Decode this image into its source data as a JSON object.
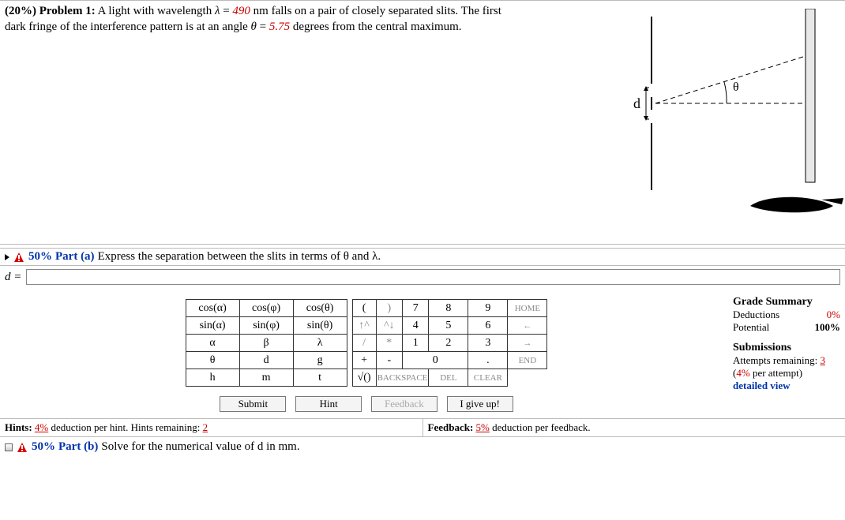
{
  "problem": {
    "weight_label": "(20%)  Problem 1:",
    "text_before_lambda": "   A light with wavelength ",
    "lambda_sym": "λ",
    "equals": " = ",
    "lambda_val": "490",
    "lambda_unit": " nm falls on a pair of closely separated slits. The first dark fringe of the interference pattern is at an angle ",
    "theta_sym": "θ",
    "theta_val": "5.75",
    "text_after": " degrees from the central maximum."
  },
  "diagram": {
    "d_label": "d",
    "theta_label": "θ"
  },
  "part_a": {
    "weight": "50%",
    "label": "Part (a)",
    "prompt": "  Express the separation between the slits in terms of θ and λ.",
    "lhs": "d = ",
    "input_value": ""
  },
  "keypad": {
    "funcs": [
      [
        "cos(α)",
        "cos(φ)",
        "cos(θ)"
      ],
      [
        "sin(α)",
        "sin(φ)",
        "sin(θ)"
      ],
      [
        "α",
        "β",
        "λ"
      ],
      [
        "θ",
        "d",
        "g"
      ],
      [
        "h",
        "m",
        "t"
      ]
    ],
    "nums": [
      {
        "cells": [
          {
            "t": "(",
            "w": 1
          },
          {
            "t": ")",
            "w": 1,
            "sym": true
          },
          {
            "t": "7",
            "w": 1
          },
          {
            "t": "8",
            "w": 1
          },
          {
            "t": "9",
            "w": 1
          },
          {
            "t": "HOME",
            "w": 1,
            "home": true
          }
        ]
      },
      {
        "cells": [
          {
            "t": "↑^",
            "w": 1,
            "sym": true
          },
          {
            "t": "^↓",
            "w": 1,
            "sym": true
          },
          {
            "t": "4",
            "w": 1
          },
          {
            "t": "5",
            "w": 1
          },
          {
            "t": "6",
            "w": 1
          },
          {
            "t": "←",
            "w": 1,
            "home": true
          }
        ]
      },
      {
        "cells": [
          {
            "t": "/",
            "w": 1,
            "sym": true
          },
          {
            "t": "*",
            "w": 1,
            "sym": true
          },
          {
            "t": "1",
            "w": 1
          },
          {
            "t": "2",
            "w": 1
          },
          {
            "t": "3",
            "w": 1
          },
          {
            "t": "→",
            "w": 1,
            "home": true
          }
        ]
      },
      {
        "cells": [
          {
            "t": "+",
            "w": 1
          },
          {
            "t": "-",
            "w": 1
          },
          {
            "t": "0",
            "w": 2
          },
          {
            "t": ".",
            "w": 1
          },
          {
            "t": "END",
            "w": 1,
            "home": true
          }
        ]
      },
      {
        "cells": [
          {
            "t": "√()",
            "w": 1
          },
          {
            "t": "BACKSPACE",
            "w": 2,
            "wide": true
          },
          {
            "t": "DEL",
            "w": 1,
            "home": true
          },
          {
            "t": "CLEAR",
            "w": 1,
            "home": true
          }
        ]
      }
    ]
  },
  "actions": {
    "submit": "Submit",
    "hint": "Hint",
    "feedback": "Feedback",
    "giveup": "I give up!"
  },
  "summary": {
    "title": "Grade Summary",
    "ded_label": "Deductions",
    "ded_val": "0%",
    "pot_label": "Potential",
    "pot_val": "100%",
    "sub_title": "Submissions",
    "att_label": "Attempts remaining: ",
    "att_val": "3",
    "per_attempt_pre": "(",
    "per_attempt_val": "4%",
    "per_attempt_post": " per attempt)",
    "detailed": "detailed view"
  },
  "hints": {
    "left_pre": "Hints: ",
    "left_pct": "4%",
    "left_mid": "  deduction per hint. Hints remaining: ",
    "left_rem": "2",
    "right_pre": "Feedback: ",
    "right_pct": "5%",
    "right_post": "  deduction per feedback."
  },
  "part_b": {
    "weight": "50%",
    "label": "Part (b)",
    "prompt": "  Solve for the numerical value of d in mm."
  }
}
